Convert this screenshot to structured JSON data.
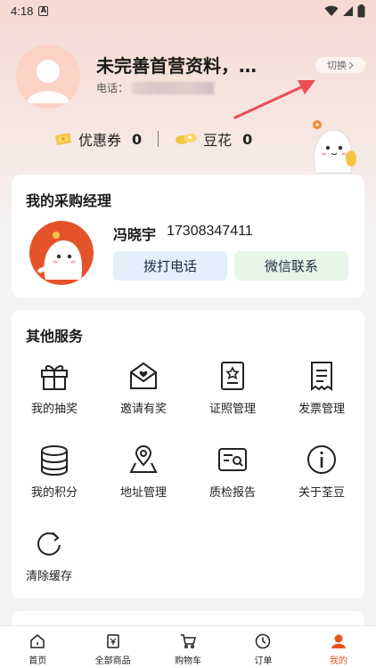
{
  "status_bar": {
    "time": "4:18",
    "notif_letter": "A"
  },
  "profile": {
    "name": "未完善首营资料，…",
    "phone_label": "电话：",
    "switch_label": "切换"
  },
  "stats": {
    "coupon_label": "优惠券",
    "coupon_value": "0",
    "beans_label": "豆花",
    "beans_value": "0"
  },
  "manager_card": {
    "title": "我的采购经理",
    "name": "冯晓宇",
    "phone": "17308347411",
    "call_label": "拨打电话",
    "wechat_label": "微信联系"
  },
  "services": {
    "title": "其他服务",
    "items": [
      {
        "label": "我的抽奖",
        "icon": "gift-icon"
      },
      {
        "label": "邀请有奖",
        "icon": "invite-envelope-icon"
      },
      {
        "label": "证照管理",
        "icon": "certificate-icon"
      },
      {
        "label": "发票管理",
        "icon": "invoice-icon"
      },
      {
        "label": "我的积分",
        "icon": "points-stack-icon"
      },
      {
        "label": "地址管理",
        "icon": "location-pin-icon"
      },
      {
        "label": "质检报告",
        "icon": "inspection-report-icon"
      },
      {
        "label": "关于荃豆",
        "icon": "info-icon"
      },
      {
        "label": "清除缓存",
        "icon": "refresh-icon"
      }
    ]
  },
  "bottom_nav": {
    "items": [
      {
        "label": "首页",
        "icon": "home-icon"
      },
      {
        "label": "全部商品",
        "icon": "all-products-icon"
      },
      {
        "label": "购物车",
        "icon": "cart-icon"
      },
      {
        "label": "订单",
        "icon": "clock-icon"
      },
      {
        "label": "我的",
        "icon": "user-icon"
      }
    ],
    "active_index": 4
  },
  "colors": {
    "accent": "#e8531f",
    "call_bg": "#e3f0fb",
    "wechat_bg": "#e6f6e8",
    "arrow": "#ec4d57"
  }
}
